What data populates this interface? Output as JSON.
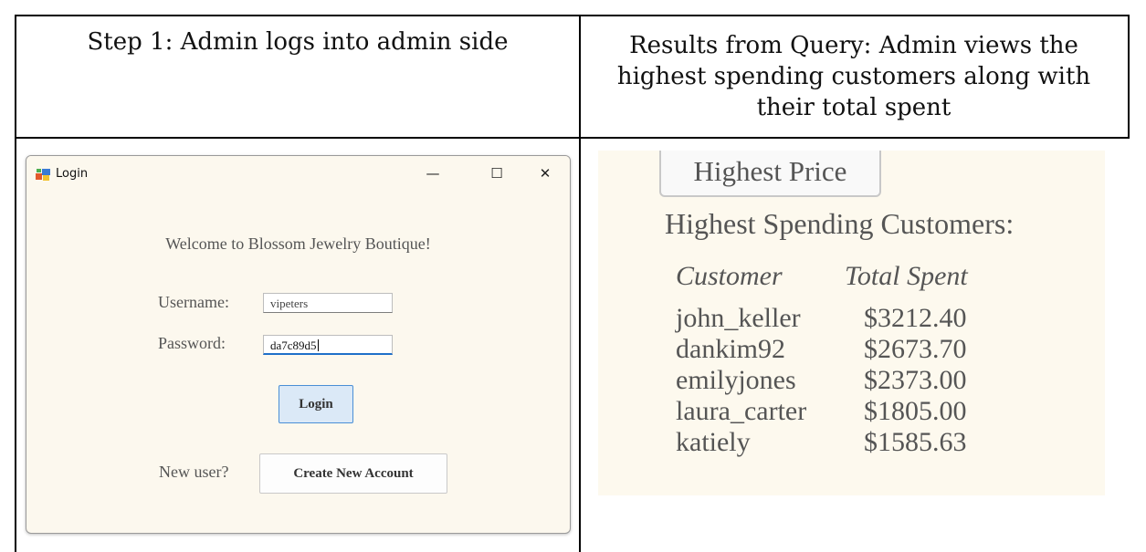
{
  "table": {
    "header_left": "Step 1: Admin logs into admin side",
    "header_right": "Results from Query: Admin views the highest spending customers along with their total spent"
  },
  "login_window": {
    "title": "Login",
    "controls": {
      "minimize": "—",
      "maximize": "☐",
      "close": "✕"
    },
    "welcome": "Welcome to Blossom Jewelry Boutique!",
    "username_label": "Username:",
    "username_value": "vipeters",
    "password_label": "Password:",
    "password_value": "da7c89d5",
    "login_button": "Login",
    "new_user_label": "New user?",
    "create_account_button": "Create New Account"
  },
  "results": {
    "button_label": "Highest Price",
    "heading": "Highest Spending Customers:",
    "columns": [
      "Customer",
      "Total Spent"
    ],
    "rows": [
      {
        "customer": "john_keller",
        "total": "$3212.40"
      },
      {
        "customer": "dankim92",
        "total": "$2673.70"
      },
      {
        "customer": "emilyjones",
        "total": "$2373.00"
      },
      {
        "customer": "laura_carter",
        "total": "$1805.00"
      },
      {
        "customer": "katiely",
        "total": "$1585.63"
      }
    ]
  }
}
